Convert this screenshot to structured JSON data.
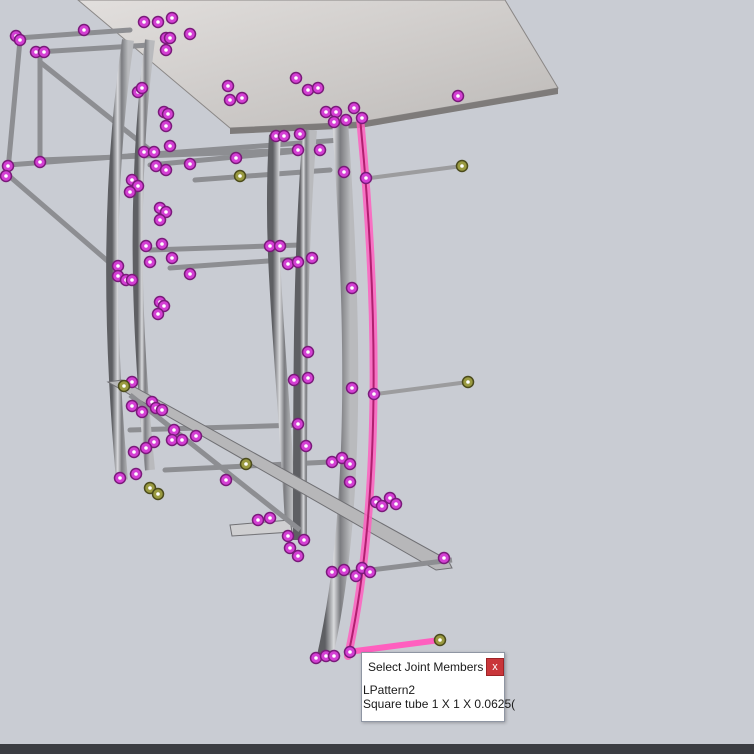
{
  "viewport": {
    "background": "#c9ccd3",
    "colors": {
      "selection": "#ff5fbf",
      "joint_marker": "#d43fd4",
      "joint_marker_inactive": "#8a8a3a",
      "tabletop": "#cfcccb",
      "steel": "#8f9094"
    }
  },
  "tooltip": {
    "title": "Select Joint Members",
    "close_label": "x",
    "lines": [
      "LPattern2",
      "Square tube 1 X 1 X 0.0625("
    ]
  }
}
